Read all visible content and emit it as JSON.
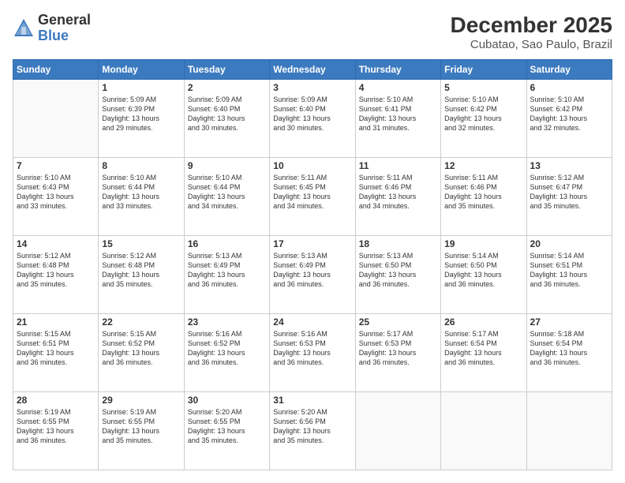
{
  "logo": {
    "general": "General",
    "blue": "Blue"
  },
  "title": "December 2025",
  "subtitle": "Cubatao, Sao Paulo, Brazil",
  "days_header": [
    "Sunday",
    "Monday",
    "Tuesday",
    "Wednesday",
    "Thursday",
    "Friday",
    "Saturday"
  ],
  "weeks": [
    [
      {
        "num": "",
        "info": ""
      },
      {
        "num": "1",
        "info": "Sunrise: 5:09 AM\nSunset: 6:39 PM\nDaylight: 13 hours\nand 29 minutes."
      },
      {
        "num": "2",
        "info": "Sunrise: 5:09 AM\nSunset: 6:40 PM\nDaylight: 13 hours\nand 30 minutes."
      },
      {
        "num": "3",
        "info": "Sunrise: 5:09 AM\nSunset: 6:40 PM\nDaylight: 13 hours\nand 30 minutes."
      },
      {
        "num": "4",
        "info": "Sunrise: 5:10 AM\nSunset: 6:41 PM\nDaylight: 13 hours\nand 31 minutes."
      },
      {
        "num": "5",
        "info": "Sunrise: 5:10 AM\nSunset: 6:42 PM\nDaylight: 13 hours\nand 32 minutes."
      },
      {
        "num": "6",
        "info": "Sunrise: 5:10 AM\nSunset: 6:42 PM\nDaylight: 13 hours\nand 32 minutes."
      }
    ],
    [
      {
        "num": "7",
        "info": "Sunrise: 5:10 AM\nSunset: 6:43 PM\nDaylight: 13 hours\nand 33 minutes."
      },
      {
        "num": "8",
        "info": "Sunrise: 5:10 AM\nSunset: 6:44 PM\nDaylight: 13 hours\nand 33 minutes."
      },
      {
        "num": "9",
        "info": "Sunrise: 5:10 AM\nSunset: 6:44 PM\nDaylight: 13 hours\nand 34 minutes."
      },
      {
        "num": "10",
        "info": "Sunrise: 5:11 AM\nSunset: 6:45 PM\nDaylight: 13 hours\nand 34 minutes."
      },
      {
        "num": "11",
        "info": "Sunrise: 5:11 AM\nSunset: 6:46 PM\nDaylight: 13 hours\nand 34 minutes."
      },
      {
        "num": "12",
        "info": "Sunrise: 5:11 AM\nSunset: 6:46 PM\nDaylight: 13 hours\nand 35 minutes."
      },
      {
        "num": "13",
        "info": "Sunrise: 5:12 AM\nSunset: 6:47 PM\nDaylight: 13 hours\nand 35 minutes."
      }
    ],
    [
      {
        "num": "14",
        "info": "Sunrise: 5:12 AM\nSunset: 6:48 PM\nDaylight: 13 hours\nand 35 minutes."
      },
      {
        "num": "15",
        "info": "Sunrise: 5:12 AM\nSunset: 6:48 PM\nDaylight: 13 hours\nand 35 minutes."
      },
      {
        "num": "16",
        "info": "Sunrise: 5:13 AM\nSunset: 6:49 PM\nDaylight: 13 hours\nand 36 minutes."
      },
      {
        "num": "17",
        "info": "Sunrise: 5:13 AM\nSunset: 6:49 PM\nDaylight: 13 hours\nand 36 minutes."
      },
      {
        "num": "18",
        "info": "Sunrise: 5:13 AM\nSunset: 6:50 PM\nDaylight: 13 hours\nand 36 minutes."
      },
      {
        "num": "19",
        "info": "Sunrise: 5:14 AM\nSunset: 6:50 PM\nDaylight: 13 hours\nand 36 minutes."
      },
      {
        "num": "20",
        "info": "Sunrise: 5:14 AM\nSunset: 6:51 PM\nDaylight: 13 hours\nand 36 minutes."
      }
    ],
    [
      {
        "num": "21",
        "info": "Sunrise: 5:15 AM\nSunset: 6:51 PM\nDaylight: 13 hours\nand 36 minutes."
      },
      {
        "num": "22",
        "info": "Sunrise: 5:15 AM\nSunset: 6:52 PM\nDaylight: 13 hours\nand 36 minutes."
      },
      {
        "num": "23",
        "info": "Sunrise: 5:16 AM\nSunset: 6:52 PM\nDaylight: 13 hours\nand 36 minutes."
      },
      {
        "num": "24",
        "info": "Sunrise: 5:16 AM\nSunset: 6:53 PM\nDaylight: 13 hours\nand 36 minutes."
      },
      {
        "num": "25",
        "info": "Sunrise: 5:17 AM\nSunset: 6:53 PM\nDaylight: 13 hours\nand 36 minutes."
      },
      {
        "num": "26",
        "info": "Sunrise: 5:17 AM\nSunset: 6:54 PM\nDaylight: 13 hours\nand 36 minutes."
      },
      {
        "num": "27",
        "info": "Sunrise: 5:18 AM\nSunset: 6:54 PM\nDaylight: 13 hours\nand 36 minutes."
      }
    ],
    [
      {
        "num": "28",
        "info": "Sunrise: 5:19 AM\nSunset: 6:55 PM\nDaylight: 13 hours\nand 36 minutes."
      },
      {
        "num": "29",
        "info": "Sunrise: 5:19 AM\nSunset: 6:55 PM\nDaylight: 13 hours\nand 35 minutes."
      },
      {
        "num": "30",
        "info": "Sunrise: 5:20 AM\nSunset: 6:55 PM\nDaylight: 13 hours\nand 35 minutes."
      },
      {
        "num": "31",
        "info": "Sunrise: 5:20 AM\nSunset: 6:56 PM\nDaylight: 13 hours\nand 35 minutes."
      },
      {
        "num": "",
        "info": ""
      },
      {
        "num": "",
        "info": ""
      },
      {
        "num": "",
        "info": ""
      }
    ]
  ]
}
